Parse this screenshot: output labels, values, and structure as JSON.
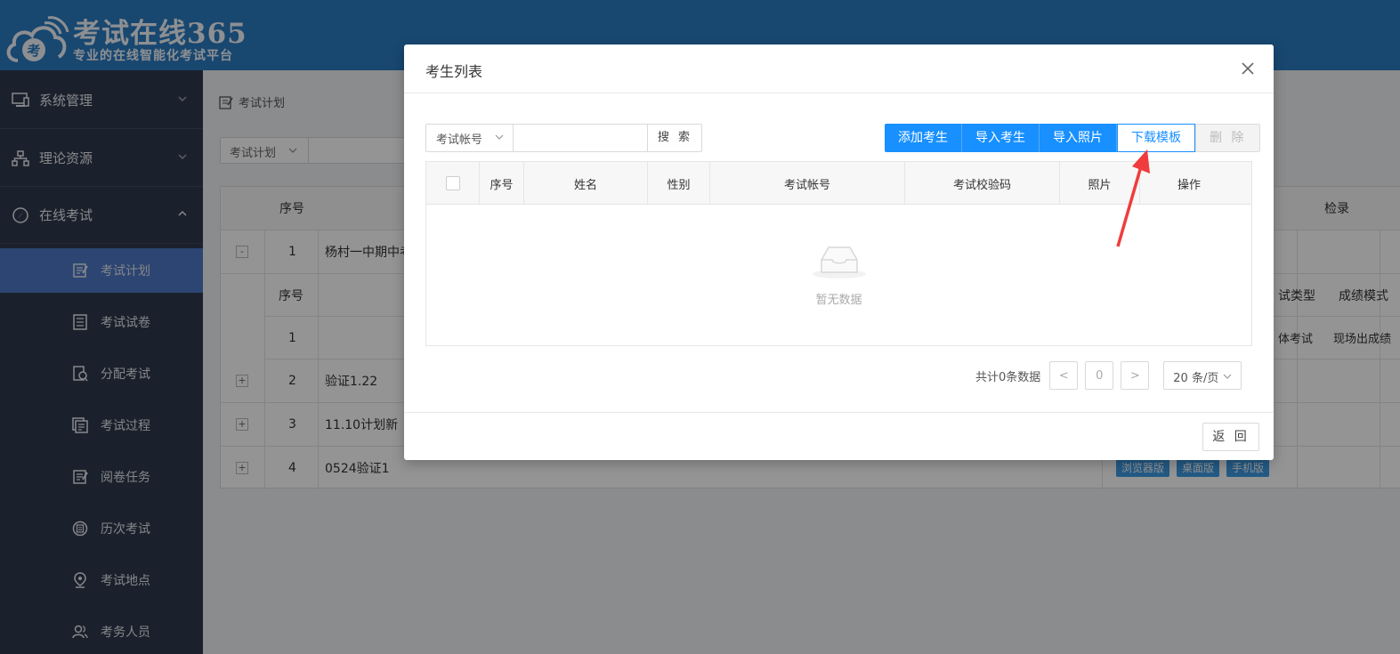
{
  "logo": {
    "title": "考试在线365",
    "subtitle": "专业的在线智能化考试平台",
    "cloud_char": "考"
  },
  "sidebar": {
    "groups": [
      {
        "label": "系统管理",
        "icon": "monitor-icon",
        "expanded": false
      },
      {
        "label": "理论资源",
        "icon": "sitemap-icon",
        "expanded": false
      },
      {
        "label": "在线考试",
        "icon": "compass-icon",
        "expanded": true
      }
    ],
    "items": [
      {
        "label": "考试计划",
        "icon": "edit-doc-icon",
        "active": true
      },
      {
        "label": "考试试卷",
        "icon": "paper-icon",
        "active": false
      },
      {
        "label": "分配考试",
        "icon": "assign-icon",
        "active": false
      },
      {
        "label": "考试过程",
        "icon": "process-icon",
        "active": false
      },
      {
        "label": "阅卷任务",
        "icon": "marking-icon",
        "active": false
      },
      {
        "label": "历次考试",
        "icon": "history-icon",
        "active": false
      },
      {
        "label": "考试地点",
        "icon": "location-icon",
        "active": false
      },
      {
        "label": "考务人员",
        "icon": "staff-icon",
        "active": false
      }
    ]
  },
  "background": {
    "breadcrumb": "考试计划",
    "filter_label": "考试计划",
    "table": {
      "header_index": "序号",
      "header_right": "检录",
      "rows": [
        {
          "toggle": "-",
          "index": "1",
          "name": "杨村一中期中考"
        },
        {
          "toggle": "+",
          "index": "2",
          "name": "验证1.22"
        },
        {
          "toggle": "+",
          "index": "3",
          "name": "11.10计划新"
        },
        {
          "toggle": "+",
          "index": "4",
          "name": "0524验证1"
        }
      ],
      "sub_header": {
        "index": "序号",
        "type": "试类型",
        "mode": "成绩模式"
      },
      "sub_row": {
        "index": "1",
        "type": "体考试",
        "mode": "现场出成绩"
      },
      "tags": [
        "浏览器版",
        "桌面版",
        "手机版"
      ]
    }
  },
  "modal": {
    "title": "考生列表",
    "search": {
      "field_label": "考试帐号",
      "placeholder": "",
      "button": "搜 索"
    },
    "buttons": {
      "add": "添加考生",
      "import": "导入考生",
      "import_photo": "导入照片",
      "download_template": "下载模板",
      "delete": "删 除"
    },
    "table_headers": {
      "index": "序号",
      "name": "姓名",
      "gender": "性别",
      "account": "考试帐号",
      "code": "考试校验码",
      "photo": "照片",
      "action": "操作"
    },
    "empty_text": "暂无数据",
    "pagination": {
      "total": "共计0条数据",
      "page": "0",
      "page_size": "20 条/页",
      "prev": "<",
      "next": ">"
    },
    "back_button": "返 回"
  },
  "colors": {
    "header": "#2a7bc2",
    "sidebar": "#2f3a4c",
    "active": "#4d78c4",
    "primary": "#1890ff",
    "arrow": "#f03c3c"
  }
}
